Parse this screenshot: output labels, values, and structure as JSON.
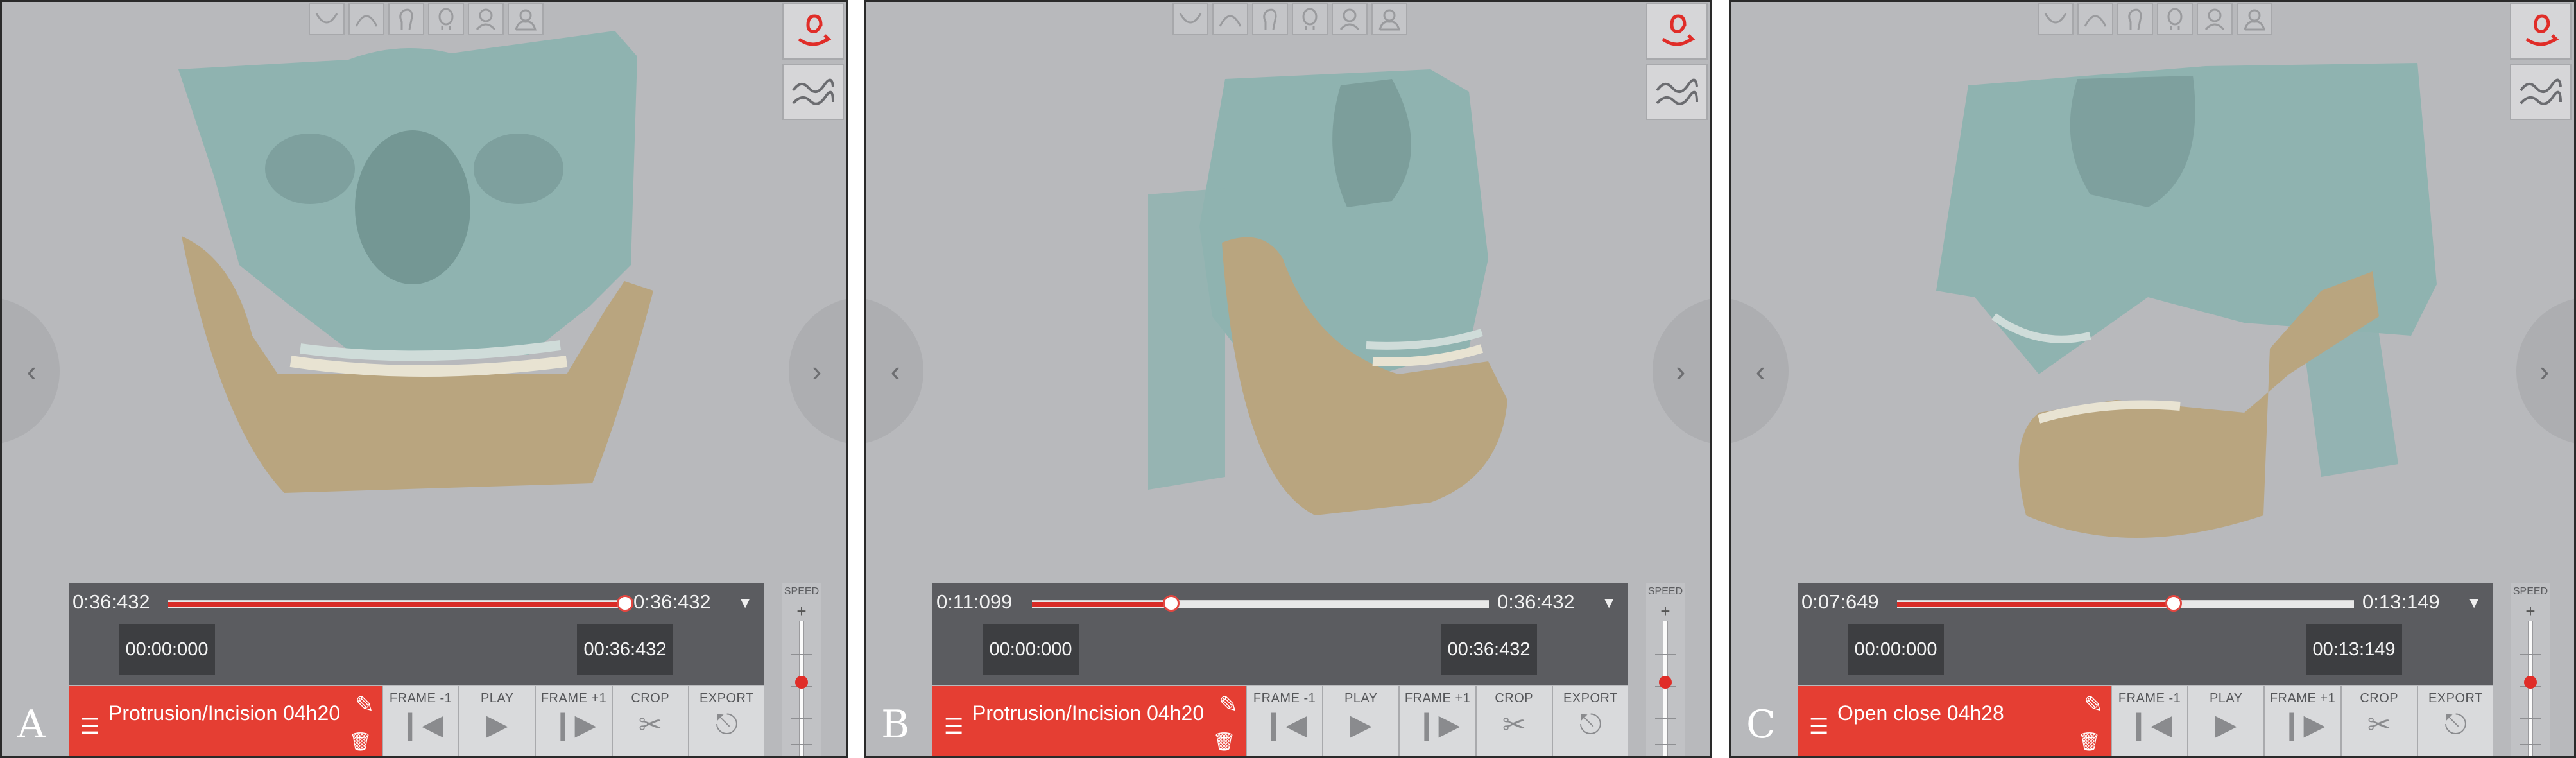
{
  "panels": [
    {
      "letter": "A",
      "view": "front",
      "progress": 1.0,
      "current_time": "0:36:432",
      "total_time": "0:36:432",
      "range_start": "00:00:000",
      "range_end": "00:36:432",
      "clip_name": "Protrusion/Incision 04h20"
    },
    {
      "letter": "B",
      "view": "three-quarter",
      "progress": 0.305,
      "current_time": "0:11:099",
      "total_time": "0:36:432",
      "range_start": "00:00:000",
      "range_end": "00:36:432",
      "clip_name": "Protrusion/Incision 04h20"
    },
    {
      "letter": "C",
      "view": "side",
      "progress": 0.605,
      "current_time": "0:07:649",
      "total_time": "0:13:149",
      "range_start": "00:00:000",
      "range_end": "00:13:149",
      "clip_name": "Open close 04h28"
    }
  ],
  "controls": {
    "frame_back": "FRAME -1",
    "play": "PLAY",
    "frame_forward": "FRAME +1",
    "crop": "CROP",
    "export": "EXPORT"
  },
  "speed_label": "SPEED",
  "speed_level": 0.26,
  "icons": {
    "menu": "hamburger-icon",
    "edit": "pencil-icon",
    "delete": "trash-icon",
    "frame_back": "step-back-icon",
    "play": "play-icon",
    "frame_forward": "step-forward-icon",
    "crop": "scissors-icon",
    "export": "export-icon",
    "trajectory": "trajectory-icon",
    "curve": "wave-curve-icon"
  },
  "colors": {
    "accent": "#e53e33",
    "bone_maxilla": "#8fb3b0",
    "bone_mandible": "#b9a57f",
    "timeline_bg": "#5b5c60",
    "viewport_bg": "#b8b9bc"
  }
}
